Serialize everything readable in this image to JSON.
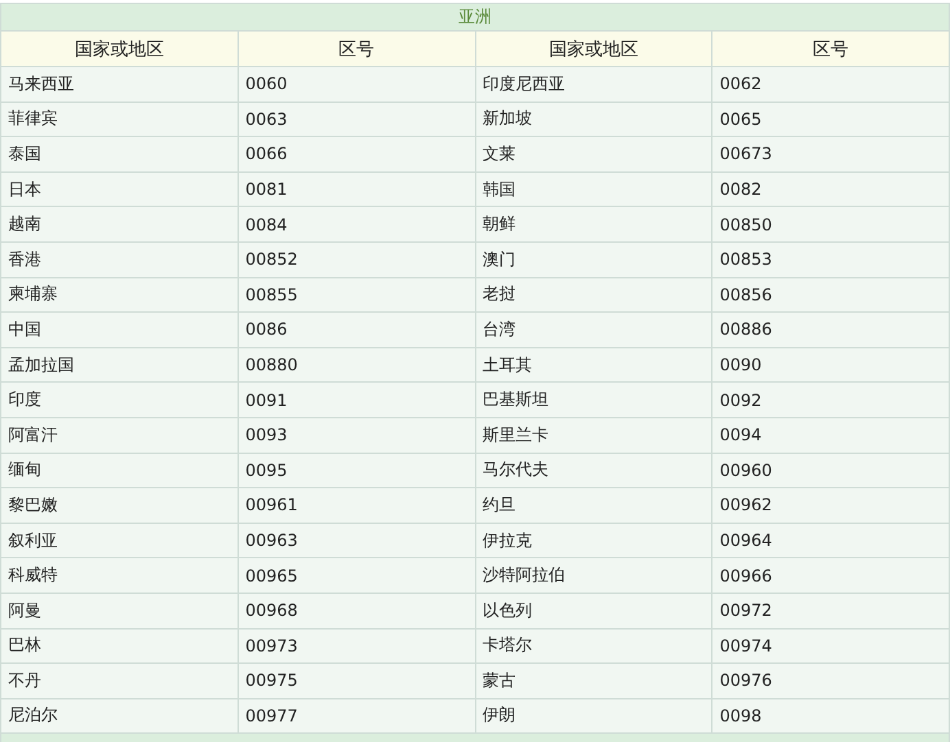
{
  "section_title": "亚洲",
  "columns": [
    "国家或地区",
    "区号",
    "国家或地区",
    "区号"
  ],
  "rows": [
    [
      "马来西亚",
      "0060",
      "印度尼西亚",
      "0062"
    ],
    [
      "菲律宾",
      "0063",
      "新加坡",
      "0065"
    ],
    [
      "泰国",
      "0066",
      "文莱",
      "00673"
    ],
    [
      "日本",
      "0081",
      "韩国",
      "0082"
    ],
    [
      "越南",
      "0084",
      "朝鲜",
      "00850"
    ],
    [
      "香港",
      "00852",
      "澳门",
      "00853"
    ],
    [
      "柬埔寨",
      "00855",
      "老挝",
      "00856"
    ],
    [
      "中国",
      "0086",
      "台湾",
      "00886"
    ],
    [
      "孟加拉国",
      "00880",
      "土耳其",
      "0090"
    ],
    [
      "印度",
      "0091",
      "巴基斯坦",
      "0092"
    ],
    [
      "阿富汗",
      "0093",
      "斯里兰卡",
      "0094"
    ],
    [
      "缅甸",
      "0095",
      "马尔代夫",
      "00960"
    ],
    [
      "黎巴嫩",
      "00961",
      "约旦",
      "00962"
    ],
    [
      "叙利亚",
      "00963",
      "伊拉克",
      "00964"
    ],
    [
      "科威特",
      "00965",
      "沙特阿拉伯",
      "00966"
    ],
    [
      "阿曼",
      "00968",
      "以色列",
      "00972"
    ],
    [
      "巴林",
      "00973",
      "卡塔尔",
      "00974"
    ],
    [
      "不丹",
      "00975",
      "蒙古",
      "00976"
    ],
    [
      "尼泊尔",
      "00977",
      "伊朗",
      "0098"
    ]
  ]
}
